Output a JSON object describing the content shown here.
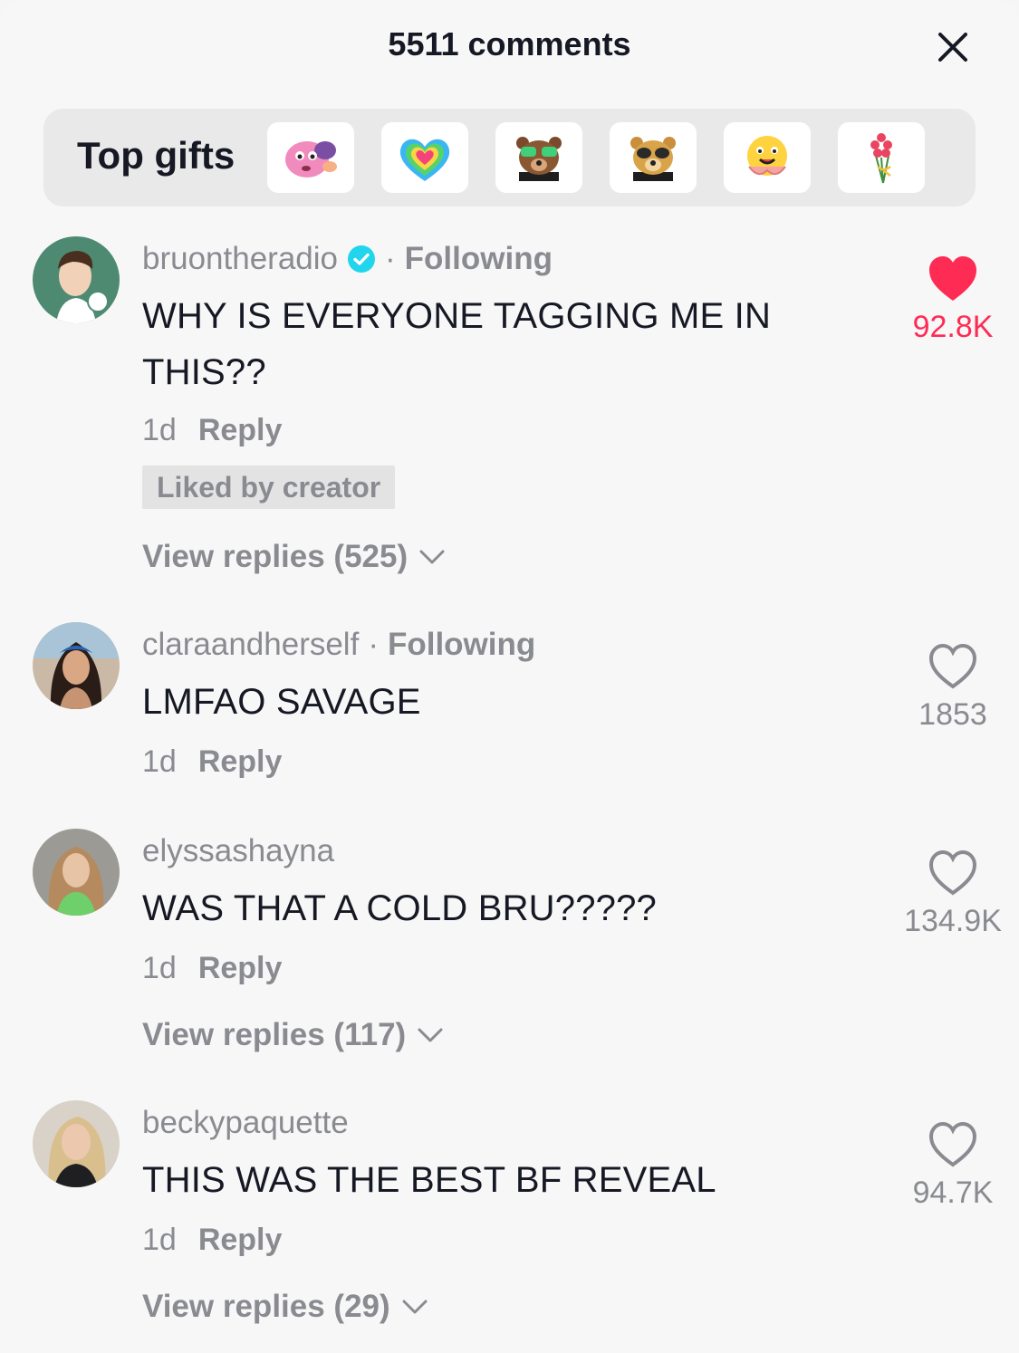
{
  "header": {
    "title": "5511 comments",
    "close_icon": "close-icon"
  },
  "gifts": {
    "label": "Top gifts",
    "items": [
      {
        "icon": "pink-cat-gift-icon"
      },
      {
        "icon": "rainbow-heart-gift-icon"
      },
      {
        "icon": "bear-with-glasses-gift-icon"
      },
      {
        "icon": "sunglasses-bear-gift-icon"
      },
      {
        "icon": "hug-face-gift-icon"
      },
      {
        "icon": "rose-bouquet-gift-icon"
      }
    ]
  },
  "comments": [
    {
      "username": "bruontheradio",
      "verified": true,
      "following": "Following",
      "separator": "·",
      "text_line1": "WHY IS EVERYONE TAGGING ME IN",
      "text_line2": "THIS??",
      "time": "1d",
      "reply": "Reply",
      "liked_by_creator": "Liked by creator",
      "view_replies": "View replies (525)",
      "likes": "92.8K",
      "liked": true
    },
    {
      "username": "claraandherself",
      "following": "Following",
      "separator": "·",
      "text": "LMFAO SAVAGE",
      "time": "1d",
      "reply": "Reply",
      "likes": "1853",
      "liked": false
    },
    {
      "username": "elyssashayna",
      "text": "WAS THAT A COLD BRU?????",
      "time": "1d",
      "reply": "Reply",
      "view_replies": "View replies (117)",
      "likes": "134.9K",
      "liked": false
    },
    {
      "username": "beckypaquette",
      "text": "THIS WAS THE BEST BF REVEAL",
      "time": "1d",
      "reply": "Reply",
      "view_replies": "View replies (29)",
      "likes": "94.7K",
      "liked": false
    }
  ],
  "colors": {
    "accent_red": "#fe2c55",
    "verified_blue": "#20d5ec",
    "muted": "#8a8b91",
    "text": "#161823"
  }
}
